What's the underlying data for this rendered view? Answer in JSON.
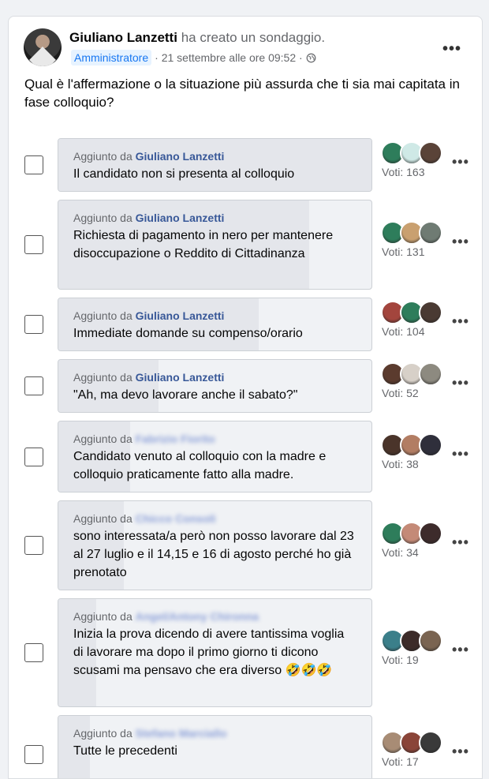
{
  "post": {
    "author": "Giuliano Lanzetti",
    "action": "ha creato un sondaggio.",
    "role_badge": "Amministratore",
    "timestamp": "· 21 settembre alle ore 09:52 ·",
    "privacy_icon": "globe-icon",
    "more_icon": "•••",
    "question": "Qual è l'affermazione o la situazione più assurda che ti sia mai capitata in fase colloquio?"
  },
  "poll": {
    "added_prefix": "Aggiunto da",
    "options": [
      {
        "author": "Giuliano Lanzetti",
        "author_blurred": false,
        "text": "Il candidato non si presenta al colloquio",
        "votes": "Voti: 163",
        "fill": 1.0,
        "voters": [
          "#2e7d5b",
          "#cfe9e6",
          "#5a4338"
        ]
      },
      {
        "author": "Giuliano Lanzetti",
        "author_blurred": false,
        "text": "Richiesta di pagamento in nero per mantenere disoccupazione o Reddito di Cittadinanza",
        "votes": "Voti: 131",
        "fill": 0.8,
        "voters": [
          "#2e7d5b",
          "#c9a070",
          "#6f7b73"
        ]
      },
      {
        "author": "Giuliano Lanzetti",
        "author_blurred": false,
        "text": "Immediate domande su compenso/orario",
        "votes": "Voti: 104",
        "fill": 0.64,
        "voters": [
          "#a3453d",
          "#2e7d5b",
          "#4a3a33"
        ]
      },
      {
        "author": "Giuliano Lanzetti",
        "author_blurred": false,
        "text": "\"Ah, ma devo lavorare anche il sabato?\"",
        "votes": "Voti: 52",
        "fill": 0.32,
        "voters": [
          "#5b3b2e",
          "#d7d0c8",
          "#8d8a80"
        ]
      },
      {
        "author": "Fabrizio Fiorito",
        "author_blurred": true,
        "text": "Candidato venuto al colloquio con la madre e colloquio praticamente fatto alla madre.",
        "votes": "Voti: 38",
        "fill": 0.23,
        "voters": [
          "#4a342a",
          "#b27d63",
          "#2f2f3b"
        ]
      },
      {
        "author": "Chicco Consoli",
        "author_blurred": true,
        "text": "sono interessata/a però non posso lavorare dal 23 al 27 luglio e il 14,15 e 16 di agosto perché ho già prenotato",
        "votes": "Voti: 34",
        "fill": 0.21,
        "voters": [
          "#2e7d5b",
          "#c48a77",
          "#3d2b2b"
        ]
      },
      {
        "author": "Angel/Antony Chironna",
        "author_blurred": true,
        "text": "Inizia la prova dicendo di avere tantissima voglia di lavorare ma dopo il primo giorno ti dicono scusami ma pensavo che era diverso 🤣🤣🤣",
        "votes": "Voti: 19",
        "fill": 0.12,
        "voters": [
          "#3b7f8a",
          "#3c2b29",
          "#7a6451"
        ]
      },
      {
        "author": "Stefano Marciallo",
        "author_blurred": true,
        "text": "Tutte le precedenti",
        "votes": "Voti: 17",
        "fill": 0.1,
        "voters": [
          "#a88c75",
          "#8a4438",
          "#3a3a3a"
        ]
      }
    ]
  }
}
